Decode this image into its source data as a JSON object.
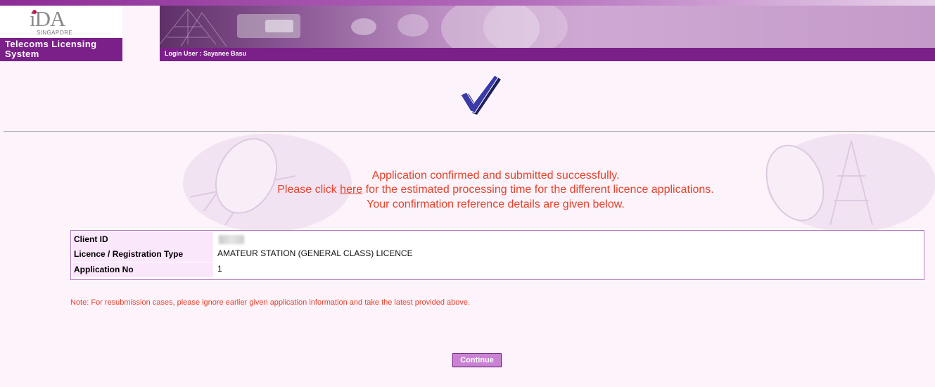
{
  "header": {
    "logo_text": "iDA",
    "logo_subtitle": "SINGAPORE",
    "system_title": "Telecoms Licensing System",
    "login_label": "Login User : Sayanee Basu"
  },
  "messages": {
    "line1": "Application confirmed and submitted successfully.",
    "line2_before": "Please click ",
    "line2_link": "here",
    "line2_after": " for the estimated processing time for the different licence applications.",
    "line3": "Your confirmation reference details are given below."
  },
  "details": {
    "rows": [
      {
        "label": "Client ID",
        "value": ""
      },
      {
        "label": "Licence / Registration Type",
        "value": "AMATEUR STATION (GENERAL CLASS) LICENCE"
      },
      {
        "label": "Application No",
        "value": "1"
      }
    ]
  },
  "note": "Note: For resubmission cases, please ignore earlier given application information and take the latest provided above.",
  "continue_button": "Continue",
  "colors": {
    "brand_purple": "#7b1f89",
    "page_background": "#fcf3fb",
    "message_red": "#e8412a",
    "button_fill": "#c983d2"
  }
}
